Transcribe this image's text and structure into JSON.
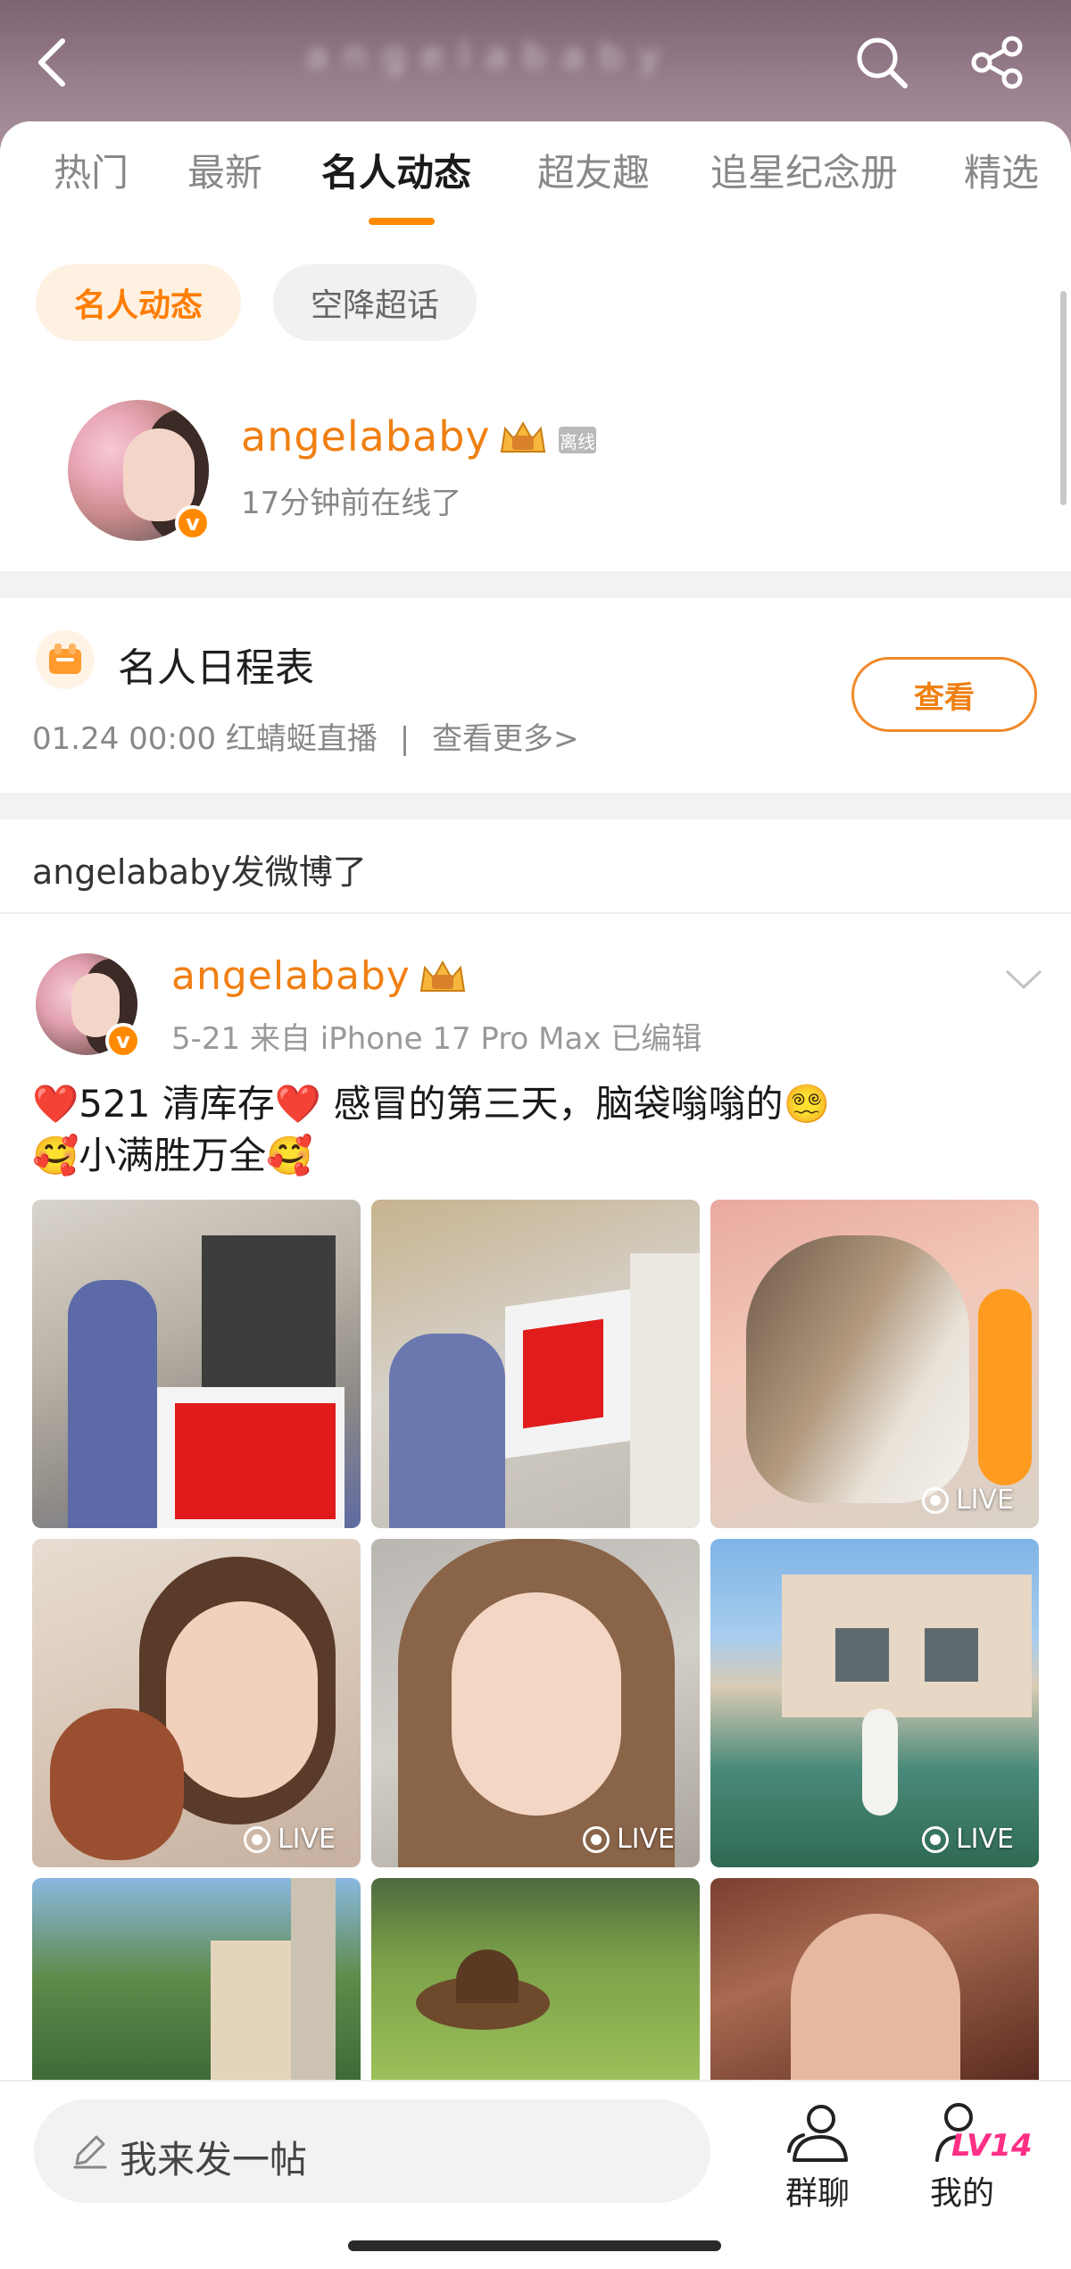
{
  "header": {
    "title": "angelababy",
    "back_icon": "chevron-left-icon",
    "search_icon": "search-icon",
    "share_icon": "share-icon"
  },
  "tabs": [
    {
      "label": "热门"
    },
    {
      "label": "最新"
    },
    {
      "label": "名人动态"
    },
    {
      "label": "超友趣"
    },
    {
      "label": "追星纪念册"
    },
    {
      "label": "精选"
    }
  ],
  "active_tab": "名人动态",
  "chips": [
    {
      "label": "名人动态",
      "active": true
    },
    {
      "label": "空降超话",
      "active": false
    }
  ],
  "celebrity": {
    "name": "angelababy",
    "offline_tag": "离线",
    "status": "17分钟前在线了"
  },
  "schedule": {
    "title": "名人日程表",
    "info": "01.24 00:00 红蜻蜓直播",
    "separator": "|",
    "more": "查看更多>",
    "button": "查看"
  },
  "section_header": "angelababy发微博了",
  "post": {
    "author": "angelababy",
    "meta": "5-21  来自 iPhone 17 Pro Max  已编辑",
    "text_line1": "❤️521 清库存❤️ 感冒的第三天，脑袋嗡嗡的😵‍💫",
    "text_line2": "🥰小满胜万全🥰",
    "photos": [
      {
        "live": false
      },
      {
        "live": false
      },
      {
        "live": true,
        "live_label": "LIVE"
      },
      {
        "live": true,
        "live_label": "LIVE"
      },
      {
        "live": true,
        "live_label": "LIVE"
      },
      {
        "live": true,
        "live_label": "LIVE"
      },
      {
        "live": false
      },
      {
        "live": false
      },
      {
        "live": false
      }
    ]
  },
  "bottom_bar": {
    "compose_placeholder": "我来发一帖",
    "group_chat": "群聊",
    "mine": "我的",
    "level_badge": "LV14"
  },
  "colors": {
    "accent": "#ff8a00",
    "name_orange": "#f07f12",
    "level_pink": "#ff2f86"
  }
}
